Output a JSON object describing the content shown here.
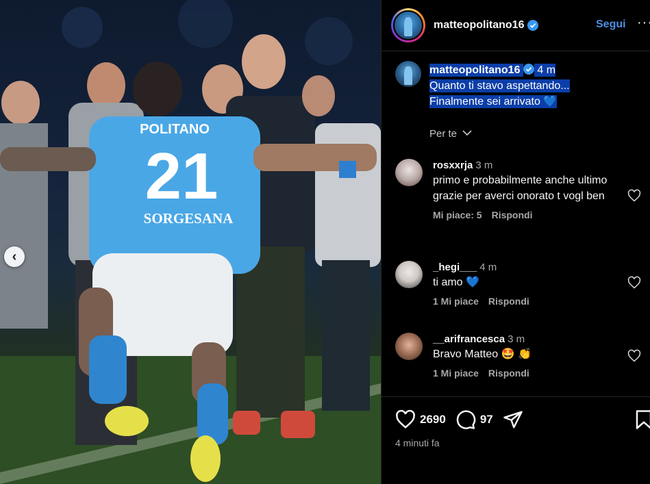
{
  "post": {
    "username": "matteopolitano16",
    "follow_label": "Segui",
    "more_label": "···",
    "caption": {
      "username": "matteopolitano16",
      "time": "4 m",
      "line1": "Quanto ti stavo aspettando...",
      "line2": "Finalmente sei arrivato",
      "emoji": "💙"
    },
    "filter_label": "Per te",
    "likes": "2690",
    "comments_count": "97",
    "time_ago": "4 minuti fa"
  },
  "photo": {
    "jersey_name": "POLITANO",
    "jersey_number": "21",
    "sponsor": "SORGESANA"
  },
  "comments": [
    {
      "username": "rosxxrja",
      "time": "3 m",
      "text": "primo e probabilmente anche ultimo grazie per averci onorato t vogl ben",
      "likes": "Mi piace: 5",
      "reply": "Rispondi"
    },
    {
      "username": "_hegi___",
      "time": "4 m",
      "text": "ti amo 💙",
      "likes": "1 Mi piace",
      "reply": "Rispondi"
    },
    {
      "username": "__arifrancesca",
      "time": "3 m",
      "text": "Bravo Matteo 🤩 👏",
      "likes": "1 Mi piace",
      "reply": "Rispondi"
    }
  ],
  "colors": {
    "follow": "#4b8fe3",
    "highlight": "#0b3ea8",
    "jersey": "#4aa7e6"
  },
  "icons": [
    "chevron-left-icon",
    "verified-icon",
    "more-icon",
    "chevron-down-icon",
    "heart-icon",
    "comment-icon",
    "share-icon",
    "bookmark-icon"
  ]
}
